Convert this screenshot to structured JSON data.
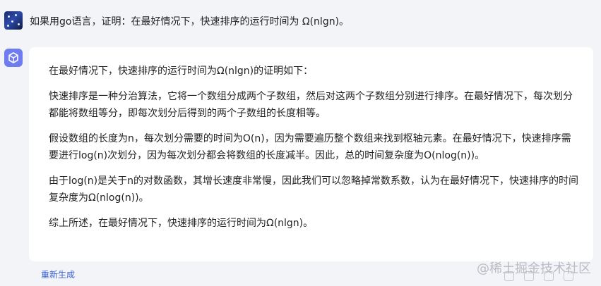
{
  "user": {
    "question": "如果用go语言，证明：在最好情况下，快速排序的运行时间为 Ω(nlgn)。"
  },
  "answer": {
    "paragraphs": [
      "在最好情况下，快速排序的运行时间为Ω(nlgn)的证明如下：",
      "快速排序是一种分治算法，它将一个数组分成两个子数组，然后对这两个子数组分别进行排序。在最好情况下，每次划分都能将数组等分，即每次划分后得到的两个子数组的长度相等。",
      "假设数组的长度为n，每次划分需要的时间为O(n)，因为需要遍历整个数组来找到枢轴元素。在最好情况下，快速排序需要进行log(n)次划分，因为每次划分都会将数组的长度减半。因此，总的时间复杂度为O(nlog(n))。",
      "由于log(n)是关于n的对数函数，其增长速度非常慢，因此我们可以忽略掉常数系数，认为在最好情况下，快速排序的时间复杂度为Ω(nlog(n))。",
      "综上所述，在最好情况下，快速排序的运行时间为Ω(nlgn)。"
    ]
  },
  "actions": {
    "regenerate_label": "重新生成"
  },
  "watermark": "@稀土掘金技术社区",
  "icons": {
    "user_avatar": "starry-night-avatar-icon",
    "bot_avatar": "cube-logo-icon"
  }
}
